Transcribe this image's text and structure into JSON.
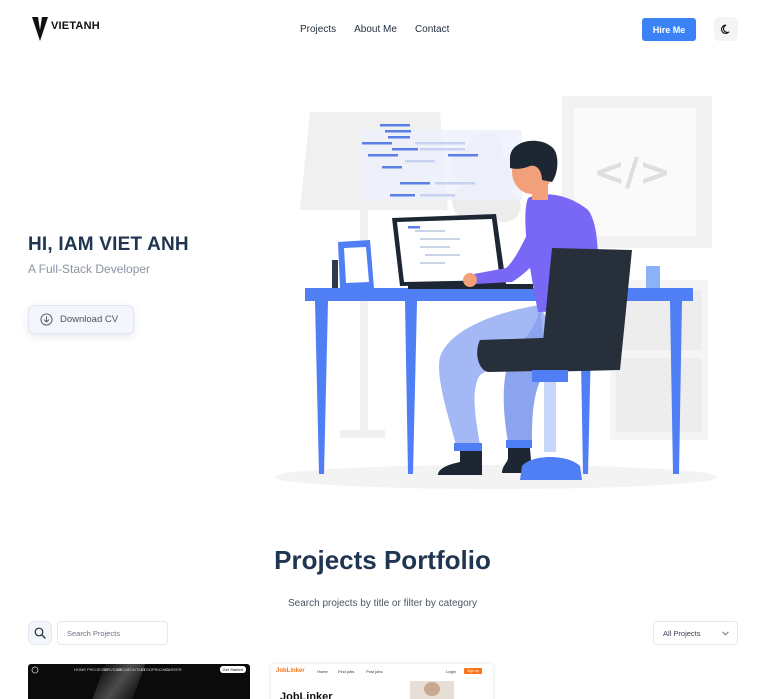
{
  "header": {
    "logo_text": "VIETANH",
    "nav": [
      "Projects",
      "About Me",
      "Contact"
    ],
    "hire_label": "Hire Me",
    "theme_icon": "moon-icon"
  },
  "hero": {
    "title": "HI, IAM VIET ANH",
    "subtitle": "A Full-Stack Developer",
    "download_label": "Download CV",
    "download_icon": "download-icon",
    "illustration_code_sign": "</>"
  },
  "portfolio": {
    "title": "Projects Portfolio",
    "subtitle": "Search projects by title or filter by category",
    "search_placeholder": "Search Projects",
    "category_selected": "All Projects",
    "cards": [
      {
        "nav": [
          "HOME",
          "PROJECTS",
          "SERVICES",
          "ABOUT",
          "CONTACT",
          "BLOG",
          "PRICING",
          "CAREER"
        ],
        "button": "Get Started"
      },
      {
        "logo": "JobLinker",
        "nav": [
          "Home",
          "Find jobs",
          "Post jobs"
        ],
        "login": "Login",
        "signup": "Sign up",
        "heading": "JobLinker"
      }
    ]
  },
  "colors": {
    "accent": "#3b82f6",
    "heading": "#1f3550",
    "muted": "#8a94a3",
    "illustration_blue": "#4f7ef5",
    "illustration_purple": "#7868f5",
    "joblinker_orange": "#f97316"
  }
}
